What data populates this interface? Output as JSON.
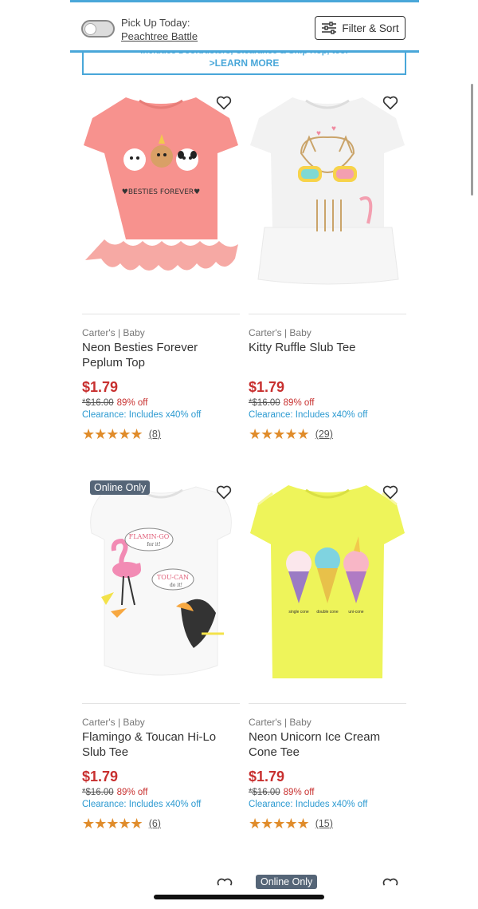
{
  "header": {
    "pickup_label": "Pick Up Today:",
    "pickup_store": "Peachtree Battle",
    "filter_label": "Filter & Sort"
  },
  "promo": {
    "partial_text": "*Includes Doorbusters, Clearance & Ship Hop, too.*",
    "learn_more": ">LEARN MORE"
  },
  "products": [
    {
      "brand": "Carter's | Baby",
      "name": "Neon Besties Forever Peplum Top",
      "price": "$1.79",
      "original_price": "*$16.00",
      "discount": "89% off",
      "clearance": "Clearance: Includes x40% off",
      "rating_stars": 5,
      "review_count": "(8)",
      "badge": "",
      "shirt_color": "#f7928e",
      "shirt_graphic_text": "♥BESTIES FOREVER♥"
    },
    {
      "brand": "Carter's | Baby",
      "name": "Kitty Ruffle Slub Tee",
      "price": "$1.79",
      "original_price": "*$16.00",
      "discount": "89% off",
      "clearance": "Clearance: Includes x40% off",
      "rating_stars": 5,
      "review_count": "(29)",
      "badge": "",
      "shirt_color": "#fafafa"
    },
    {
      "brand": "Carter's | Baby",
      "name": "Flamingo & Toucan Hi-Lo Slub Tee",
      "price": "$1.79",
      "original_price": "*$16.00",
      "discount": "89% off",
      "clearance": "Clearance: Includes x40% off",
      "rating_stars": 5,
      "review_count": "(6)",
      "badge": "Online Only",
      "shirt_color": "#f8f8f8",
      "bubble1": "FLAMIN-GO",
      "bubble1_sub": "for it!",
      "bubble2": "TOU-CAN",
      "bubble2_sub": "do it!"
    },
    {
      "brand": "Carter's | Baby",
      "name": "Neon Unicorn Ice Cream Cone Tee",
      "price": "$1.79",
      "original_price": "*$16.00",
      "discount": "89% off",
      "clearance": "Clearance: Includes x40% off",
      "rating_stars": 5,
      "review_count": "(15)",
      "badge": "",
      "shirt_color": "#eef45a",
      "cone_labels": [
        "single cone",
        "double cone",
        "uni-cone"
      ]
    }
  ],
  "next_row": {
    "badge": "Online Only"
  },
  "icons": {
    "heart": "heart-icon",
    "filter": "sliders-icon",
    "star": "star-icon"
  },
  "colors": {
    "accent_blue": "#49a7d9",
    "price_red": "#c8302f",
    "star_orange": "#e08c2b",
    "badge_slate": "#556577"
  }
}
